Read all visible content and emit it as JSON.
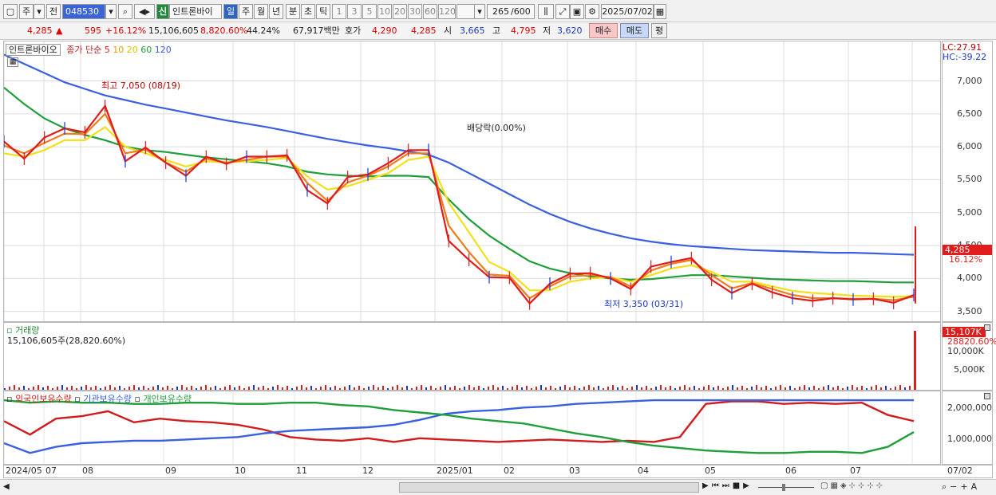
{
  "toolbar": {
    "market": "주",
    "prev": "전",
    "code": "048530",
    "new_badge": "신",
    "stock_name": "인트론바이",
    "periods": [
      "일",
      "주",
      "월",
      "년",
      "분",
      "초",
      "틱"
    ],
    "active_period": "일",
    "ticks": [
      "1",
      "3",
      "5",
      "10",
      "20",
      "30",
      "60",
      "120"
    ],
    "count": "265",
    "count_max": "/600",
    "date": "2025/07/02"
  },
  "quote": {
    "price": "4,285",
    "arrow": "▲",
    "change": "595",
    "change_pct": "+16.12%",
    "volume": "15,106,605",
    "volume_pct": "8,820.60%",
    "turnover": "44.24%",
    "amount": "67,917백만",
    "hoga_label": "호가",
    "ask": "4,290",
    "bid": "4,285",
    "open_label": "시",
    "open": "3,665",
    "high_label": "고",
    "high": "4,795",
    "low_label": "저",
    "low": "3,620",
    "buy": "매수",
    "sell": "매도",
    "eval": "평"
  },
  "price_pane": {
    "stock_tab": "인트론바이오",
    "legend": {
      "title": "종가 단순",
      "ma": [
        "5",
        "10",
        "20",
        "60",
        "120"
      ]
    },
    "ma_colors": {
      "5": "#e01c1c",
      "10": "#f07c1c",
      "20": "#f2e01a",
      "60": "#1f9e3a",
      "120": "#3a5fe0"
    },
    "annotations": {
      "high": "최고 7,050 (08/19)",
      "low": "최저 3,350 (03/31)",
      "dividend": "배당락(0.00%)"
    },
    "lc": "LC:27.91",
    "hc": "HC:-39.22",
    "current_price": "4,285",
    "current_pct": "16.12%"
  },
  "volume_pane": {
    "title": "거래량",
    "info": "15,106,605주(28,820.60%)",
    "current": "15,107K",
    "current_pct": "28820.60%",
    "axis": [
      "10,000K",
      "5,000K"
    ]
  },
  "holding_pane": {
    "legend": [
      "외국인보유수량",
      "기관보유수량",
      "개인보유수량"
    ],
    "axis": [
      "2,000,000",
      "1,000,000"
    ]
  },
  "x_axis": {
    "labels": [
      "2024/05",
      "07",
      "08",
      "09",
      "10",
      "11",
      "12",
      "2025/01",
      "02",
      "03",
      "04",
      "05",
      "06",
      "07",
      "07/02"
    ]
  },
  "chart_data": {
    "type": "line",
    "title": "",
    "ylim": [
      3350,
      7600
    ],
    "y_ticks": [
      3500,
      4000,
      4500,
      5000,
      5500,
      6000,
      6500,
      7000
    ],
    "months": [
      "2024/05",
      "06",
      "07",
      "08",
      "09",
      "10",
      "11",
      "12",
      "2025/01",
      "02",
      "03",
      "04",
      "05",
      "06",
      "07"
    ],
    "series": [
      {
        "name": "5",
        "values": [
          6080,
          5820,
          6140,
          6280,
          6220,
          6620,
          5780,
          5990,
          5760,
          5560,
          5850,
          5740,
          5850,
          5850,
          5870,
          5340,
          5140,
          5540,
          5580,
          5750,
          5950,
          5950,
          4570,
          4280,
          4020,
          4010,
          3620,
          3920,
          4070,
          4080,
          4000,
          3840,
          4180,
          4250,
          4310,
          3980,
          3780,
          3920,
          3790,
          3700,
          3660,
          3700,
          3680,
          3690,
          3630,
          3750
        ]
      },
      {
        "name": "10",
        "values": [
          6020,
          5900,
          6060,
          6200,
          6190,
          6500,
          5900,
          5960,
          5760,
          5620,
          5820,
          5760,
          5800,
          5850,
          5850,
          5450,
          5180,
          5460,
          5560,
          5700,
          5900,
          5900,
          4800,
          4400,
          4060,
          4040,
          3700,
          3880,
          4030,
          4050,
          4020,
          3880,
          4120,
          4220,
          4280,
          4050,
          3850,
          3930,
          3840,
          3750,
          3700,
          3700,
          3690,
          3690,
          3670,
          3720
        ]
      },
      {
        "name": "20",
        "values": [
          5900,
          5850,
          5950,
          6100,
          6100,
          6300,
          6000,
          5900,
          5800,
          5700,
          5780,
          5760,
          5780,
          5800,
          5830,
          5550,
          5350,
          5400,
          5500,
          5600,
          5800,
          5850,
          5150,
          4700,
          4250,
          4100,
          3820,
          3820,
          3950,
          4000,
          4020,
          3950,
          4050,
          4150,
          4200,
          4100,
          3950,
          3950,
          3880,
          3810,
          3780,
          3760,
          3740,
          3730,
          3720,
          3730
        ]
      },
      {
        "name": "60",
        "values": [
          6900,
          6650,
          6430,
          6280,
          6180,
          6100,
          6000,
          5950,
          5920,
          5880,
          5840,
          5810,
          5780,
          5750,
          5700,
          5620,
          5580,
          5560,
          5550,
          5560,
          5560,
          5540,
          5200,
          4900,
          4650,
          4450,
          4260,
          4150,
          4080,
          4030,
          4000,
          3980,
          3990,
          4020,
          4050,
          4050,
          4030,
          4010,
          3990,
          3980,
          3970,
          3960,
          3960,
          3950,
          3940,
          3940
        ]
      },
      {
        "name": "120",
        "values": [
          7400,
          7260,
          7120,
          6980,
          6880,
          6780,
          6710,
          6640,
          6580,
          6520,
          6460,
          6400,
          6350,
          6300,
          6240,
          6180,
          6120,
          6070,
          6020,
          5980,
          5930,
          5880,
          5760,
          5600,
          5440,
          5280,
          5120,
          4980,
          4860,
          4760,
          4680,
          4610,
          4560,
          4520,
          4490,
          4470,
          4450,
          4430,
          4420,
          4410,
          4400,
          4390,
          4390,
          4380,
          4370,
          4360
        ]
      }
    ]
  },
  "holdings_data": {
    "type": "line",
    "series": [
      {
        "name": "외국인보유수량",
        "values": [
          0.62,
          0.4,
          0.66,
          0.7,
          0.78,
          0.6,
          0.66,
          0.62,
          0.6,
          0.56,
          0.48,
          0.36,
          0.32,
          0.3,
          0.34,
          0.28,
          0.34,
          0.32,
          0.3,
          0.28,
          0.3,
          0.32,
          0.3,
          0.28,
          0.3,
          0.28,
          0.36,
          0.9,
          0.94,
          0.94,
          0.9,
          0.92,
          0.9,
          0.92,
          0.72,
          0.62
        ]
      },
      {
        "name": "기관보유수량",
        "values": [
          0.26,
          0.1,
          0.2,
          0.26,
          0.28,
          0.3,
          0.3,
          0.32,
          0.34,
          0.36,
          0.42,
          0.46,
          0.48,
          0.5,
          0.52,
          0.56,
          0.64,
          0.74,
          0.78,
          0.8,
          0.84,
          0.86,
          0.9,
          0.92,
          0.94,
          0.96,
          0.96,
          0.96,
          0.96,
          0.96,
          0.96,
          0.96,
          0.96,
          0.96,
          0.96,
          0.96
        ]
      },
      {
        "name": "개인보유수량",
        "values": [
          0.96,
          0.92,
          0.94,
          0.92,
          0.92,
          0.9,
          0.9,
          0.92,
          0.92,
          0.9,
          0.9,
          0.92,
          0.92,
          0.88,
          0.86,
          0.8,
          0.76,
          0.72,
          0.66,
          0.62,
          0.58,
          0.5,
          0.42,
          0.36,
          0.28,
          0.22,
          0.18,
          0.14,
          0.12,
          0.1,
          0.1,
          0.12,
          0.12,
          0.1,
          0.2,
          0.44
        ]
      }
    ]
  }
}
